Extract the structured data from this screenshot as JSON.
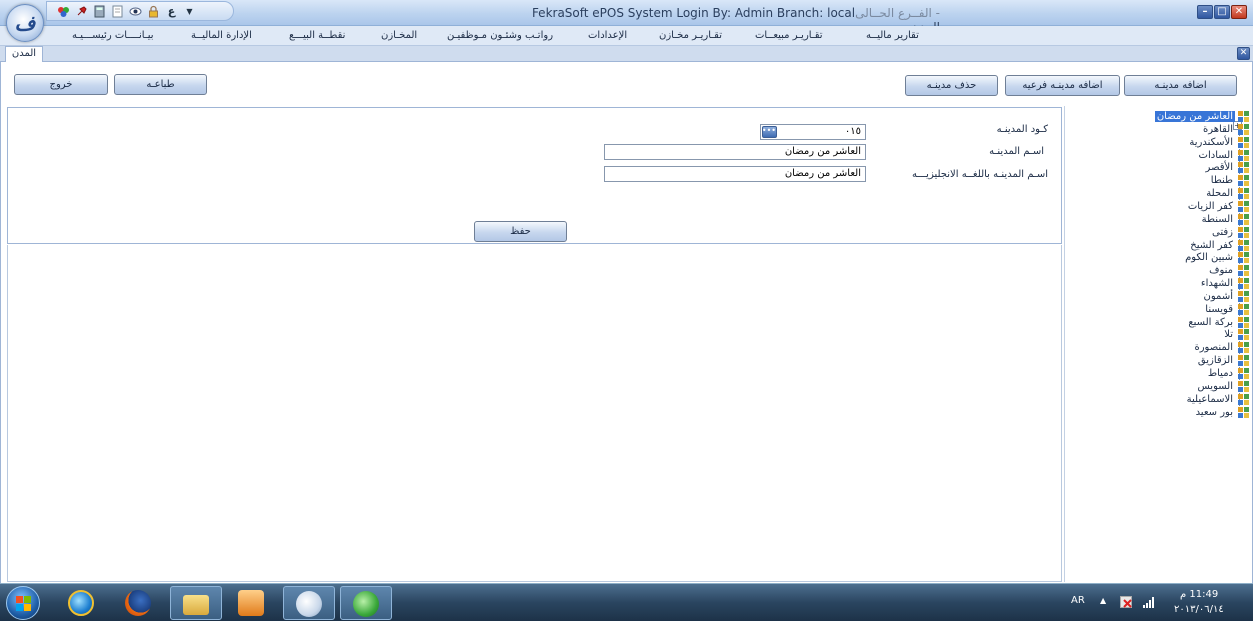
{
  "window": {
    "title_main": "FekraSoft ePOS System   Login By: Admin   Branch: local",
    "title_prefix": "المدن - ",
    "title_suffix": " - الفــرع الحــالى",
    "logo_glyph": "ف"
  },
  "quick_access": [
    "palette-icon",
    "pin-icon",
    "calculator-icon",
    "notepad-icon",
    "eye-icon",
    "lock-icon",
    "language-toggle",
    "dropdown-arrow"
  ],
  "quick_access_lang": "ع",
  "menu": {
    "items": [
      "تقارير ماليــه",
      "تقـاريـر مبيعــات",
      "تقـاريـر مخـازن",
      "الإعدادات",
      "رواتـب وشئـون مـوظفيـن",
      "المخـازن",
      "نقطــة البيـــع",
      "الإدارة الماليــة",
      "بيـانــــات رئيســـيـه"
    ]
  },
  "tab": {
    "label": "المدن"
  },
  "toolbar": {
    "add_city": "اضافه مدينـه",
    "add_subcity": "اضافه مدينـه فرعيه",
    "delete_city": "حذف مدينـه",
    "print": "طباعـه",
    "exit": "خروج"
  },
  "form": {
    "code_label": "كـود المدينـه",
    "code_value": "٠١٥",
    "name_label": "اسـم المدينـه",
    "name_value": "العاشر من رمضان",
    "name_en_label": "اسـم المدينـه باللغــه الانجليزيـــه",
    "name_en_value": "العاشر من رمضان",
    "save": "حفظ"
  },
  "tree": {
    "items": [
      "العاشر من رمضان",
      "القاهرة",
      "الأسكندرية",
      "السادات",
      "الأقصر",
      "طنطا",
      "المحلة",
      "كفر الزيات",
      "السنطة",
      "زفتى",
      "كفر الشيخ",
      "شبين الكوم",
      "منوف",
      "الشهداء",
      "أشمون",
      "قويسنا",
      "بركة السبع",
      "تلا",
      "المنصورة",
      "الزقازيق",
      "دمياط",
      "السويس",
      "الاسماعيلية",
      "بور سعيد"
    ],
    "selected_index": 0
  },
  "taskbar": {
    "apps": [
      "internet-explorer",
      "firefox",
      "file-explorer",
      "media-player",
      "paint",
      "epos-app"
    ],
    "active_app": "epos-app",
    "language": "AR",
    "time": "11:49 م",
    "date": "٢٠١٣/٠٦/١٤"
  }
}
